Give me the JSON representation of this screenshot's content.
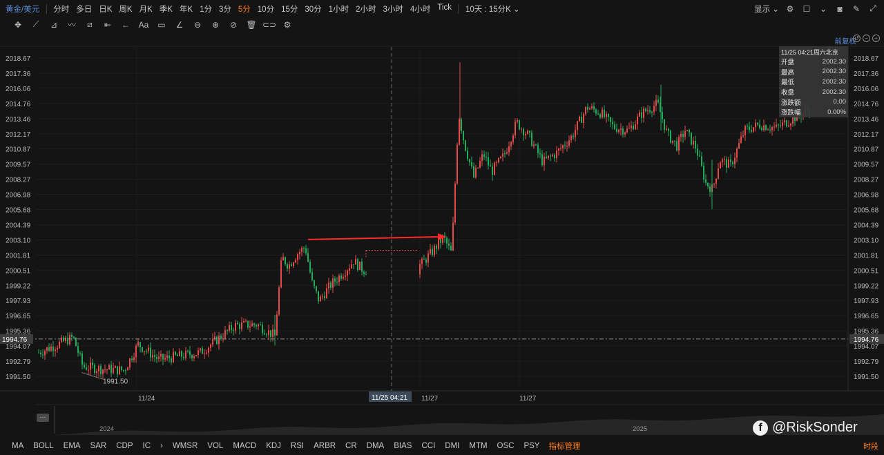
{
  "topbar": {
    "symbol": "黄金/美元",
    "periods": [
      "分时",
      "多日",
      "日K",
      "周K",
      "月K",
      "季K",
      "年K",
      "1分",
      "3分",
      "5分",
      "10分",
      "15分",
      "30分",
      "1小时",
      "2小时",
      "3小时",
      "4小时",
      "Tick"
    ],
    "active_period": "5分",
    "range_label": "10天 : 15分K",
    "display_label": "显示"
  },
  "chart": {
    "price_ticks": [
      "2018.67",
      "2017.36",
      "2016.06",
      "2014.76",
      "2013.46",
      "2012.17",
      "2010.87",
      "2009.57",
      "2008.27",
      "2006.98",
      "2005.68",
      "2004.39",
      "2003.10",
      "2001.81",
      "2000.51",
      "1999.22",
      "1997.93",
      "1996.65",
      "1995.36",
      "1994.07",
      "1992.79",
      "1991.50"
    ],
    "current_price": "1994.76",
    "min_label": "1991.50",
    "date_labels": [
      "11/24",
      "11/27",
      "11/27"
    ],
    "crosshair_date": "11/25 04:21",
    "adjust_label": "前复权",
    "colors": {
      "up": "#e84a4a",
      "down": "#1fae5b",
      "arrow": "#ff2a2a"
    }
  },
  "overlay": {
    "datetime": "11/25 04:21周六北京",
    "rows": [
      {
        "label": "开盘",
        "value": "2002.30"
      },
      {
        "label": "最高",
        "value": "2002.30"
      },
      {
        "label": "最低",
        "value": "2002.30"
      },
      {
        "label": "收盘",
        "value": "2002.30"
      },
      {
        "label": "涨跌额",
        "value": "0.00"
      },
      {
        "label": "涨跌幅",
        "value": "0.00%"
      }
    ]
  },
  "navigator": {
    "year_left": "2024",
    "year_right": "2025",
    "handle": "···"
  },
  "watermark": "@RiskSonder",
  "indicators": [
    "MA",
    "BOLL",
    "EMA",
    "SAR",
    "CDP",
    "IC",
    "WMSR",
    "VOL",
    "MACD",
    "KDJ",
    "RSI",
    "ARBR",
    "CR",
    "DMA",
    "BIAS",
    "CCI",
    "DMI",
    "MTM",
    "OSC",
    "PSY"
  ],
  "indicator_manager": "指标管理",
  "period_link": "时段"
}
